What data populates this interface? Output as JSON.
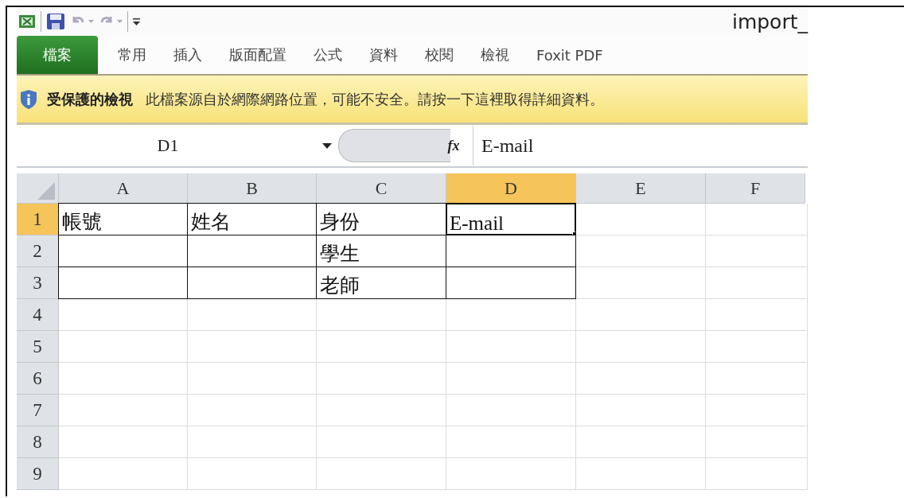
{
  "window": {
    "title": "import_"
  },
  "tabs": [
    {
      "label": "檔案",
      "kind": "file"
    },
    {
      "label": "常用",
      "kind": "tab"
    },
    {
      "label": "插入",
      "kind": "tab"
    },
    {
      "label": "版面配置",
      "kind": "tab"
    },
    {
      "label": "公式",
      "kind": "tab"
    },
    {
      "label": "資料",
      "kind": "tab"
    },
    {
      "label": "校閱",
      "kind": "tab"
    },
    {
      "label": "檢視",
      "kind": "tab"
    },
    {
      "label": "Foxit PDF",
      "kind": "tab"
    }
  ],
  "message_bar": {
    "title": "受保護的檢視",
    "text": "此檔案源自於網際網路位置，可能不安全。請按一下這裡取得詳細資料。"
  },
  "formula_bar": {
    "name_box": "D1",
    "function_label": "fx",
    "value": "E-mail"
  },
  "grid": {
    "columns": [
      {
        "label": "A",
        "selected": false
      },
      {
        "label": "B",
        "selected": false
      },
      {
        "label": "C",
        "selected": false
      },
      {
        "label": "D",
        "selected": true
      },
      {
        "label": "E",
        "selected": false
      },
      {
        "label": "F",
        "selected": false
      }
    ],
    "rows": [
      {
        "label": "1",
        "selected": true,
        "cells": [
          {
            "text": "帳號",
            "selected": false
          },
          {
            "text": "姓名",
            "selected": false
          },
          {
            "text": "身份",
            "selected": false
          },
          {
            "text": "E-mail",
            "selected": true
          }
        ]
      },
      {
        "label": "2",
        "selected": false,
        "cells": [
          {
            "selected": false
          },
          {
            "selected": false
          },
          {
            "text": "學生",
            "selected": false
          },
          {
            "selected": false
          }
        ]
      },
      {
        "label": "3",
        "selected": false,
        "cells": [
          {
            "selected": false
          },
          {
            "selected": false
          },
          {
            "text": "老師",
            "selected": false
          },
          {
            "selected": false
          }
        ]
      },
      {
        "label": "4",
        "selected": false
      },
      {
        "label": "5",
        "selected": false
      },
      {
        "label": "6",
        "selected": false
      },
      {
        "label": "7",
        "selected": false
      },
      {
        "label": "8",
        "selected": false
      },
      {
        "label": "9",
        "selected": false
      }
    ]
  }
}
